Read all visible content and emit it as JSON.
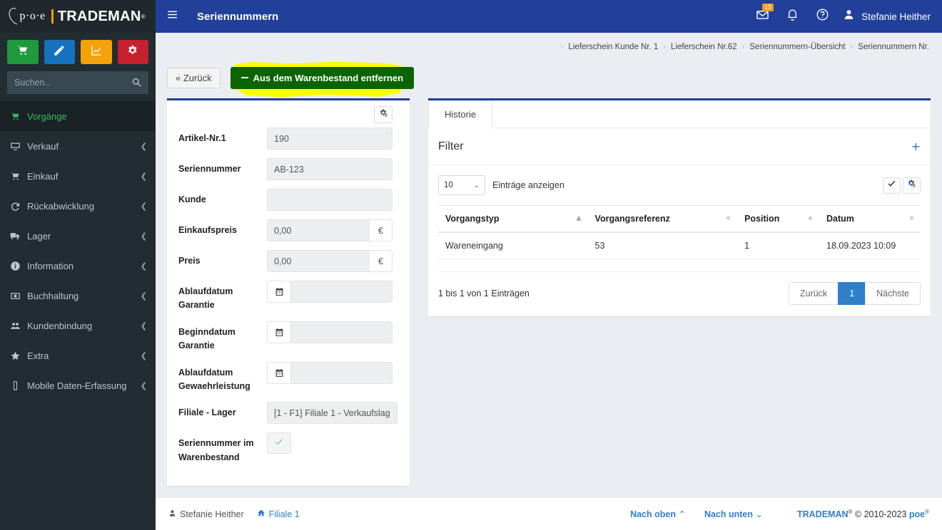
{
  "sidebar": {
    "logo": {
      "poe": "p·o·e",
      "trademan": "TRADEMAN",
      "reg": "®"
    },
    "quick_buttons": [
      {
        "name": "cart",
        "color": "#1f9b3e",
        "icon": "cart-icon"
      },
      {
        "name": "edit",
        "color": "#1672bd",
        "icon": "pencil-icon"
      },
      {
        "name": "report",
        "color": "#f5a209",
        "icon": "chart-line-icon"
      },
      {
        "name": "settings",
        "color": "#c7202f",
        "icon": "gears-icon"
      }
    ],
    "search": {
      "placeholder": "Suchen..",
      "value": ""
    },
    "items": [
      {
        "label": "Vorgänge",
        "icon": "cart-icon",
        "active": true,
        "arrow": ""
      },
      {
        "label": "Verkauf",
        "icon": "desktop-icon",
        "active": false,
        "arrow": "❮"
      },
      {
        "label": "Einkauf",
        "icon": "cart-icon",
        "active": false,
        "arrow": "❮"
      },
      {
        "label": "Rückabwicklung",
        "icon": "undo-icon",
        "active": false,
        "arrow": "❮"
      },
      {
        "label": "Lager",
        "icon": "truck-icon",
        "active": false,
        "arrow": "❮"
      },
      {
        "label": "Information",
        "icon": "info-icon",
        "active": false,
        "arrow": "❮"
      },
      {
        "label": "Buchhaltung",
        "icon": "money-icon",
        "active": false,
        "arrow": "❮"
      },
      {
        "label": "Kundenbindung",
        "icon": "users-icon",
        "active": false,
        "arrow": "❮"
      },
      {
        "label": "Extra",
        "icon": "star-icon",
        "active": false,
        "arrow": "❮"
      },
      {
        "label": "Mobile Daten-Erfassung",
        "icon": "mobile-icon",
        "active": false,
        "arrow": "❮"
      }
    ]
  },
  "header": {
    "title": "Seriennummern",
    "mail_badge": "15",
    "user_name": "Stefanie Heither",
    "brand_color": "#21409a"
  },
  "breadcrumb": {
    "separator": "›",
    "items": [
      "Lieferschein Kunde Nr. 1",
      "Lieferschein Nr.62",
      "Seriennummern-Übersicht",
      "Seriennummern Nr."
    ]
  },
  "actions": {
    "back_label": "« Zurück",
    "remove_label": "Aus dem Warenbestand entfernen",
    "remove_color": "#0a6400",
    "highlight_color": "#fbff00"
  },
  "form": {
    "fields": [
      {
        "label": "Artikel-Nr.1",
        "value": "190",
        "type": "text"
      },
      {
        "label": "Seriennummer",
        "value": "AB-123",
        "type": "text"
      },
      {
        "label": "Kunde",
        "value": "",
        "type": "text"
      },
      {
        "label": "Einkaufspreis",
        "value": "0,00",
        "type": "currency",
        "suffix": "€"
      },
      {
        "label": "Preis",
        "value": "0,00",
        "type": "currency",
        "suffix": "€"
      },
      {
        "label": "Ablaufdatum Garantie",
        "value": "",
        "type": "date"
      },
      {
        "label": "Beginndatum Garantie",
        "value": "",
        "type": "date"
      },
      {
        "label": "Ablaufdatum Gewaehrleistung",
        "value": "",
        "type": "date"
      },
      {
        "label": "Filiale - Lager",
        "value": "[1 - F1] Filiale 1 - Verkaufslag",
        "type": "text"
      },
      {
        "label": "Seriennummer im Warenbestand",
        "value": "",
        "type": "checkbox",
        "checked": true
      }
    ]
  },
  "history": {
    "tabs": [
      {
        "label": "Historie",
        "active": true
      }
    ],
    "filter_title": "Filter",
    "filter_add": "+",
    "page_length": "10",
    "page_length_label": "Einträge anzeigen",
    "columns": [
      {
        "label": "Vorgangstyp",
        "sorted": true
      },
      {
        "label": "Vorgangsreferenz",
        "sorted": false
      },
      {
        "label": "Position",
        "sorted": false
      },
      {
        "label": "Datum",
        "sorted": false
      }
    ],
    "rows": [
      [
        "Wareneingang",
        "53",
        "1",
        "18.09.2023 10:09"
      ]
    ],
    "info": "1 bis 1 von 1 Einträgen",
    "pager": {
      "prev": "Zurück",
      "pages": [
        "1"
      ],
      "next": "Nächste",
      "active_page": "1"
    }
  },
  "footer": {
    "user": "Stefanie Heither",
    "branch": "Filiale 1",
    "up_label": "Nach oben",
    "up_chev": "⌃",
    "down_label": "Nach unten",
    "down_chev": "⌄",
    "copy_brand": "TRADEMAN",
    "copy_text": "© 2010-2023",
    "copy_poe": "poe",
    "reg": "®"
  }
}
